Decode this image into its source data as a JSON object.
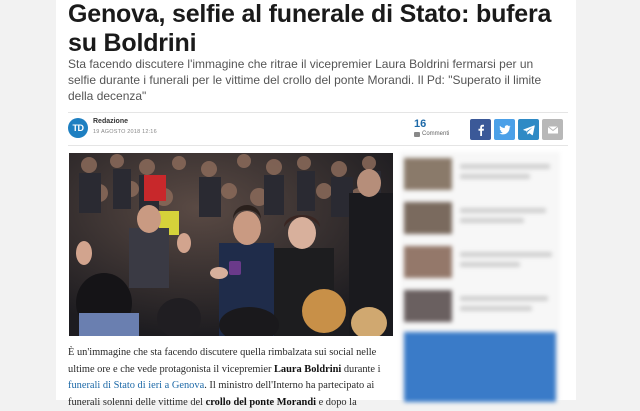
{
  "article": {
    "headline": "Genova, selfie al funerale di Stato: bufera su Boldrini",
    "subtitle": "Sta facendo discutere l'immagine che ritrae il vicepremier Laura Boldrini fermarsi per un selfie durante i funerali per le vittime del crollo del ponte Morandi. Il Pd: \"Superato il limite della decenza\"",
    "author": {
      "avatar_text": "TD",
      "name": "Redazione",
      "date": "19 AGOSTO 2018 12:16"
    },
    "comments": {
      "count": "16",
      "label": "Commenti"
    },
    "share": {
      "facebook": "facebook-icon",
      "twitter": "twitter-icon",
      "telegram": "telegram-icon",
      "email": "email-icon"
    },
    "body": {
      "p1_a": "È un'immagine che sta facendo discutere quella rimbalzata sui social nelle ultime ore e che vede protagonista il vicepremier ",
      "p1_bold": "Laura Boldrini",
      "p1_b": " durante i ",
      "p1_link": "funerali di Stato di ieri a Genova",
      "p1_c": ". Il ministro dell'Interno ha partecipato ai funerali solenni delle vittime del ",
      "p1_bold2": "crollo del ponte Morandi",
      "p1_d": " e dopo la"
    }
  },
  "colors": {
    "accent": "#1e7fc1",
    "facebook": "#3b5998",
    "twitter": "#4ba0e8",
    "telegram": "#2f8ac5",
    "link": "#1e6aa8"
  }
}
